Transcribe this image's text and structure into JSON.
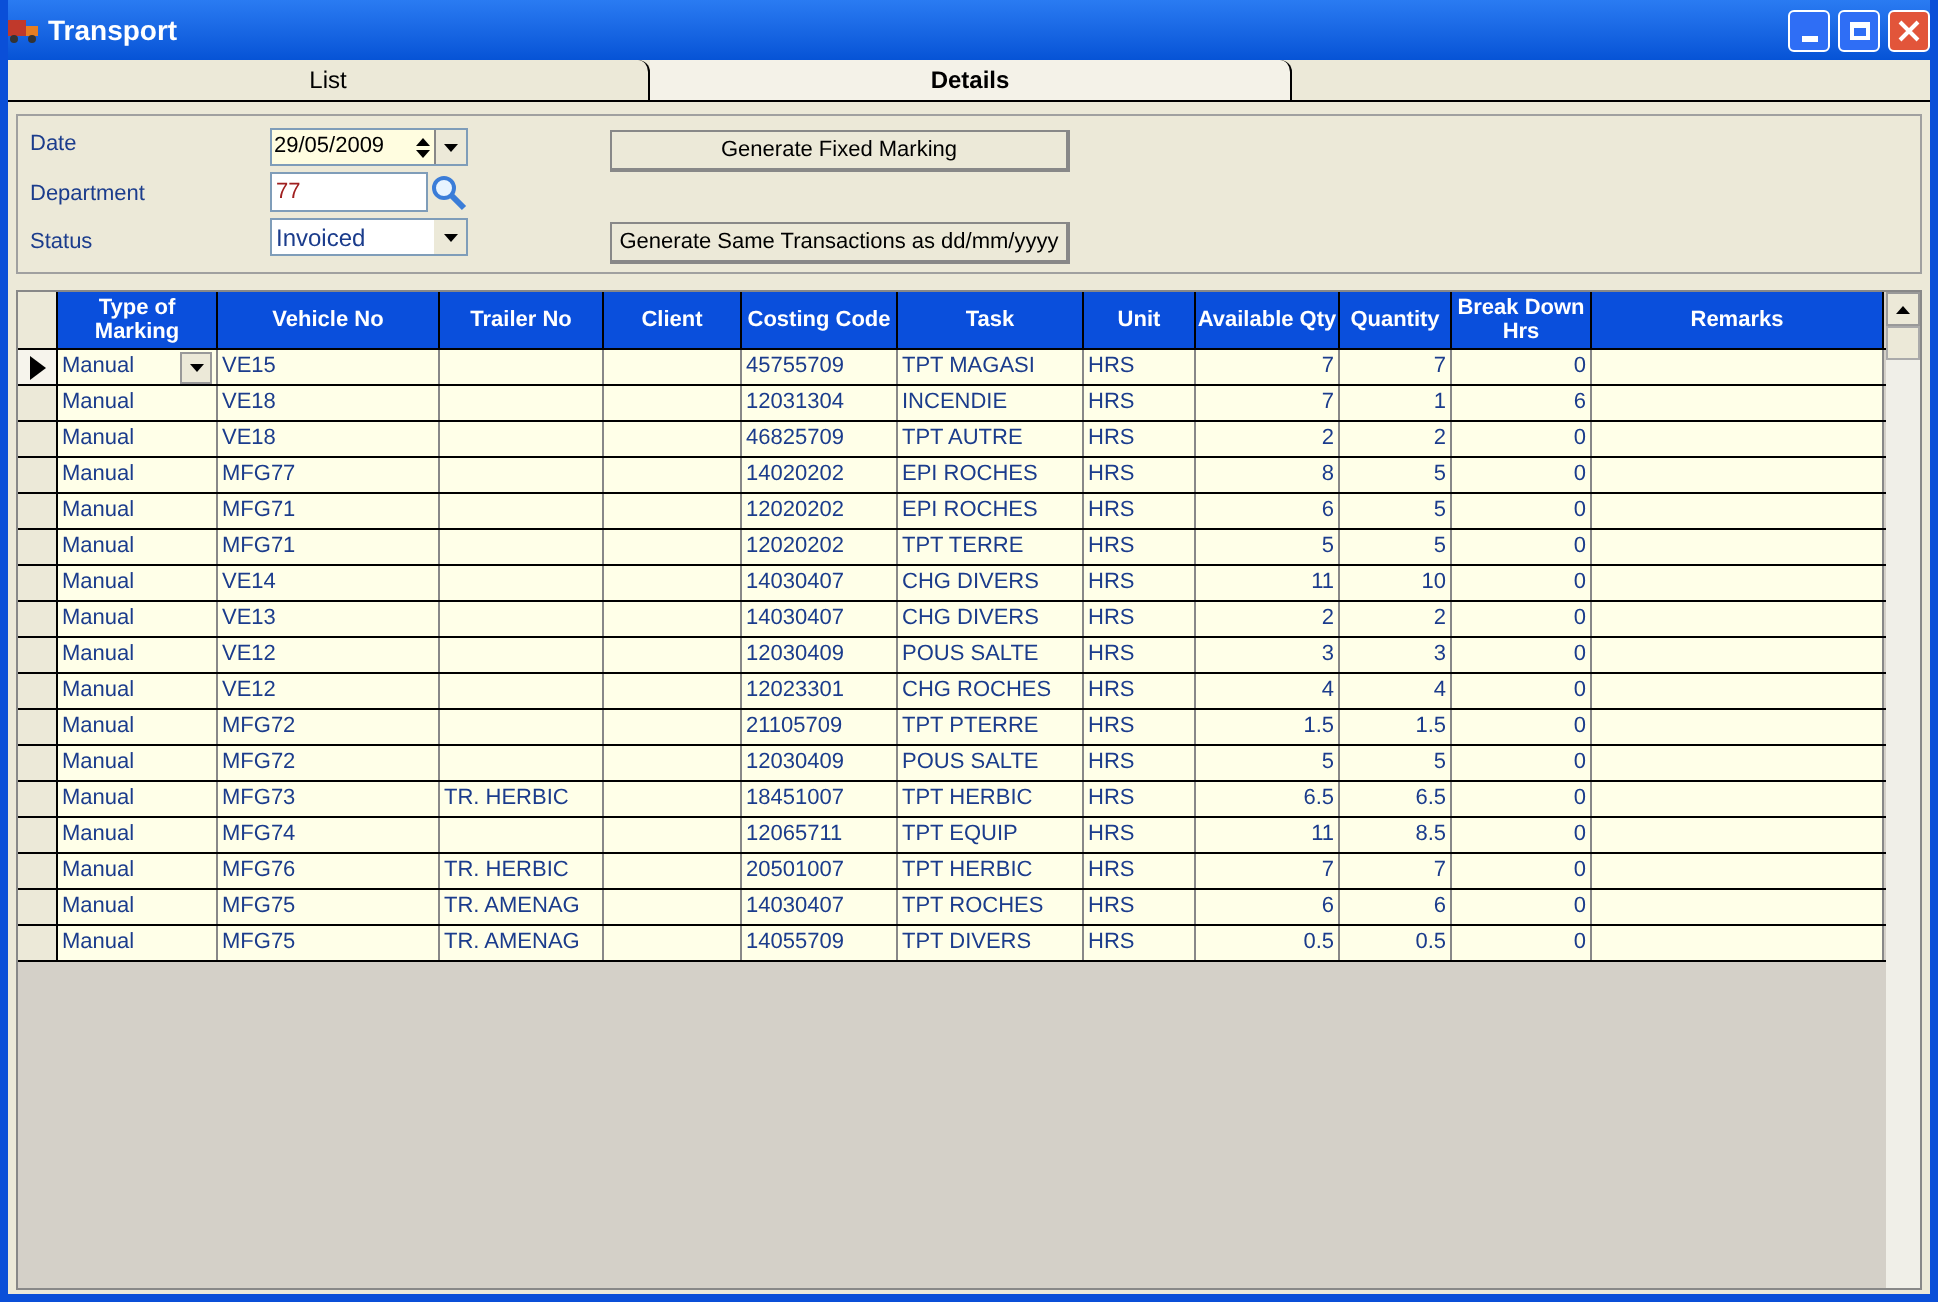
{
  "window": {
    "title": "Transport"
  },
  "tabs": [
    {
      "label": "List",
      "selected": false
    },
    {
      "label": "Details",
      "selected": true
    }
  ],
  "form": {
    "date": {
      "label": "Date",
      "value": "29/05/2009"
    },
    "department": {
      "label": "Department",
      "value": "77"
    },
    "status": {
      "label": "Status",
      "value": "Invoiced"
    }
  },
  "buttons": [
    "Generate Fixed Marking",
    "Generate Same Transactions as dd/mm/yyyy"
  ],
  "table": {
    "columns": [
      {
        "label": "Type of Marking",
        "kind": "text"
      },
      {
        "label": "Vehicle No",
        "kind": "text"
      },
      {
        "label": "Trailer No",
        "kind": "text"
      },
      {
        "label": "Client",
        "kind": "text"
      },
      {
        "label": "Costing Code",
        "kind": "text"
      },
      {
        "label": "Task",
        "kind": "text"
      },
      {
        "label": "Unit",
        "kind": "text"
      },
      {
        "label": "Available Qty",
        "kind": "number"
      },
      {
        "label": "Quantity",
        "kind": "number"
      },
      {
        "label": "Break Down Hrs",
        "kind": "number"
      },
      {
        "label": "Remarks",
        "kind": "text"
      }
    ],
    "rows": [
      {
        "selected": true,
        "cells": [
          "Manual",
          "VE15",
          "",
          "",
          "45755709",
          "TPT MAGASI",
          "HRS",
          "7",
          "7",
          "0",
          ""
        ]
      },
      {
        "selected": false,
        "cells": [
          "Manual",
          "VE18",
          "",
          "",
          "12031304",
          "INCENDIE",
          "HRS",
          "7",
          "1",
          "6",
          ""
        ]
      },
      {
        "selected": false,
        "cells": [
          "Manual",
          "VE18",
          "",
          "",
          "46825709",
          "TPT AUTRE",
          "HRS",
          "2",
          "2",
          "0",
          ""
        ]
      },
      {
        "selected": false,
        "cells": [
          "Manual",
          "MFG77",
          "",
          "",
          "14020202",
          "EPI ROCHES",
          "HRS",
          "8",
          "5",
          "0",
          ""
        ]
      },
      {
        "selected": false,
        "cells": [
          "Manual",
          "MFG71",
          "",
          "",
          "12020202",
          "EPI ROCHES",
          "HRS",
          "6",
          "5",
          "0",
          ""
        ]
      },
      {
        "selected": false,
        "cells": [
          "Manual",
          "MFG71",
          "",
          "",
          "12020202",
          "TPT TERRE",
          "HRS",
          "5",
          "5",
          "0",
          ""
        ]
      },
      {
        "selected": false,
        "cells": [
          "Manual",
          "VE14",
          "",
          "",
          "14030407",
          "CHG DIVERS",
          "HRS",
          "11",
          "10",
          "0",
          ""
        ]
      },
      {
        "selected": false,
        "cells": [
          "Manual",
          "VE13",
          "",
          "",
          "14030407",
          "CHG DIVERS",
          "HRS",
          "2",
          "2",
          "0",
          ""
        ]
      },
      {
        "selected": false,
        "cells": [
          "Manual",
          "VE12",
          "",
          "",
          "12030409",
          "POUS SALTE",
          "HRS",
          "3",
          "3",
          "0",
          ""
        ]
      },
      {
        "selected": false,
        "cells": [
          "Manual",
          "VE12",
          "",
          "",
          "12023301",
          "CHG ROCHES",
          "HRS",
          "4",
          "4",
          "0",
          ""
        ]
      },
      {
        "selected": false,
        "cells": [
          "Manual",
          "MFG72",
          "",
          "",
          "21105709",
          "TPT PTERRE",
          "HRS",
          "1.5",
          "1.5",
          "0",
          ""
        ]
      },
      {
        "selected": false,
        "cells": [
          "Manual",
          "MFG72",
          "",
          "",
          "12030409",
          "POUS SALTE",
          "HRS",
          "5",
          "5",
          "0",
          ""
        ]
      },
      {
        "selected": false,
        "cells": [
          "Manual",
          "MFG73",
          "TR. HERBIC",
          "",
          "18451007",
          "TPT HERBIC",
          "HRS",
          "6.5",
          "6.5",
          "0",
          ""
        ]
      },
      {
        "selected": false,
        "cells": [
          "Manual",
          "MFG74",
          "",
          "",
          "12065711",
          "TPT EQUIP",
          "HRS",
          "11",
          "8.5",
          "0",
          ""
        ]
      },
      {
        "selected": false,
        "cells": [
          "Manual",
          "MFG76",
          "TR. HERBIC",
          "",
          "20501007",
          "TPT HERBIC",
          "HRS",
          "7",
          "7",
          "0",
          ""
        ]
      },
      {
        "selected": false,
        "cells": [
          "Manual",
          "MFG75",
          "TR. AMENAG",
          "",
          "14030407",
          "TPT ROCHES",
          "HRS",
          "6",
          "6",
          "0",
          ""
        ]
      },
      {
        "selected": false,
        "cells": [
          "Manual",
          "MFG75",
          "TR. AMENAG",
          "",
          "14055709",
          "TPT DIVERS",
          "HRS",
          "0.5",
          "0.5",
          "0",
          ""
        ]
      }
    ]
  }
}
